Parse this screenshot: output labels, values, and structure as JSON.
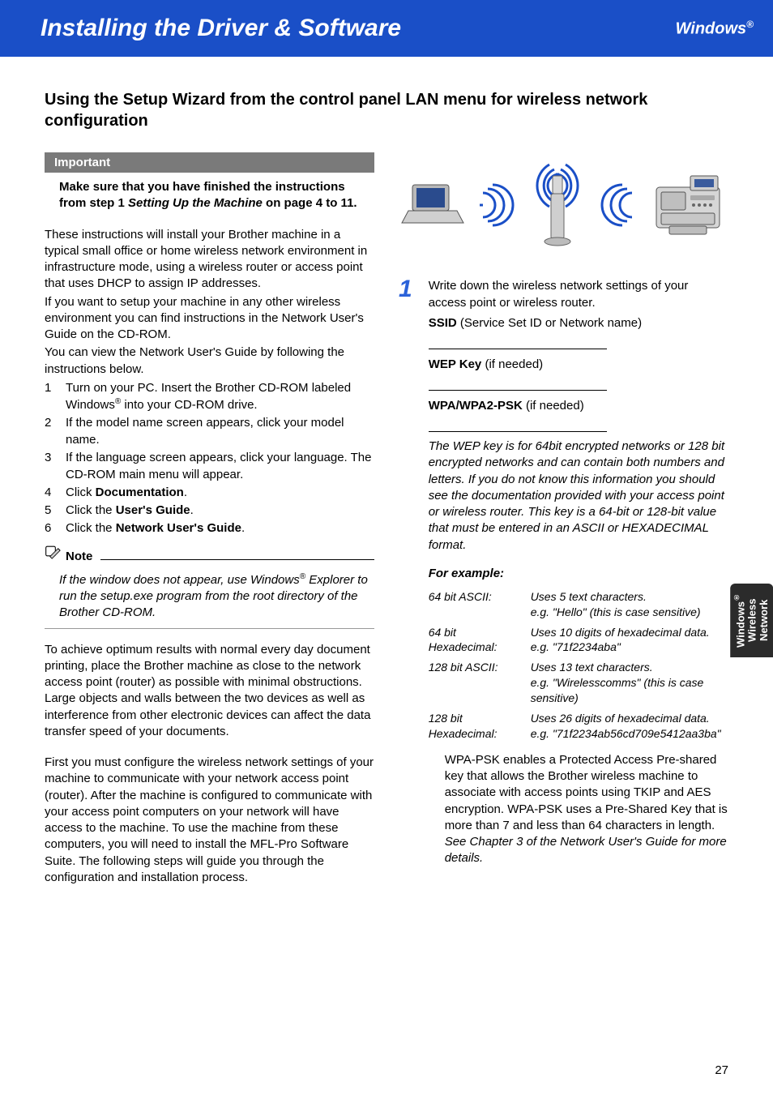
{
  "banner": {
    "title": "Installing the Driver & Software",
    "os": "Windows",
    "reg": "®"
  },
  "section_title": "Using the Setup Wizard from the control panel LAN menu for wireless network configuration",
  "important": {
    "label": "Important",
    "line1": "Make sure that you have finished the instructions from step 1",
    "line2_it": "Setting Up the Machine",
    "line3": "on page 4 to 11."
  },
  "left": {
    "p1": "These instructions will install your Brother machine in a typical small office or home wireless network environment in infrastructure mode, using a wireless router or access point that uses DHCP to assign IP addresses.",
    "p2": "If you want to setup your machine in any other wireless environment you can find instructions in the Network User's Guide on the CD-ROM.",
    "p3": "You can view the Network User's Guide by following the instructions below.",
    "li1a": "Turn on your PC. Insert the Brother CD-ROM labeled Windows",
    "li1b": " into your CD-ROM drive.",
    "li2": "If the model name screen appears, click your model name.",
    "li3": "If the language screen appears, click your language. The CD-ROM main menu will appear.",
    "li4a": "Click ",
    "li4b": "Documentation",
    "li4c": ".",
    "li5a": "Click the ",
    "li5b": "User's Guide",
    "li5c": ".",
    "li6a": "Click the ",
    "li6b": "Network User's Guide",
    "li6c": ".",
    "note_label": "Note",
    "note_body_a": "If the window does not appear, use Windows",
    "note_body_b": " Explorer to run the setup.exe program from the root directory of the Brother CD-ROM.",
    "p4": "To achieve optimum results with normal every day document printing, place the Brother machine as close to the network access point (router) as possible with minimal obstructions. Large objects and walls between the two devices as well as interference from other electronic devices can affect the data transfer speed of your documents.",
    "p5": "First you must configure the wireless network settings of your machine to communicate with your network access point (router). After the machine is configured to communicate with your access point computers on your network will have access to the machine. To use the machine from these computers, you will need to install the MFL-Pro Software Suite. The following steps will guide you through the configuration and installation process."
  },
  "right": {
    "step_num": "1",
    "step_a": "Write down the wireless network settings of your access point or wireless router.",
    "ssid_b": "SSID",
    "ssid_t": " (Service Set ID or Network name)",
    "wep_b": "WEP Key",
    "wep_t": " (if needed)",
    "wpa_b": "WPA/WPA2-PSK",
    "wpa_t": " (if needed)",
    "wep_note": "The WEP key is for 64bit encrypted networks or 128 bit encrypted networks and can contain both numbers and letters. If you do not know this information you should see the documentation provided with your access point or wireless router. This key is a 64-bit or 128-bit value that must be entered in an ASCII or HEXADECIMAL format.",
    "for_ex": "For example:",
    "ex": [
      {
        "k": "64 bit ASCII:",
        "v": "Uses 5 text characters.\ne.g. \"Hello\" (this is case sensitive)"
      },
      {
        "k": "64 bit Hexadecimal:",
        "v": "Uses 10 digits of hexadecimal data.\ne.g. \"71f2234aba\""
      },
      {
        "k": "128 bit ASCII:",
        "v": "Uses 13 text characters.\ne.g. \"Wirelesscomms\" (this is case sensitive)"
      },
      {
        "k": "128 bit Hexadecimal:",
        "v": "Uses 26 digits of hexadecimal data.\ne.g. \"71f2234ab56cd709e5412aa3ba\""
      }
    ],
    "wpa_desc": "WPA-PSK enables a Protected Access Pre-shared key that allows the Brother wireless machine to associate with access points using TKIP and AES encryption. WPA-PSK uses a Pre-Shared Key that is more than 7 and less than 64 characters in length.",
    "wpa_see": "See Chapter 3 of the Network User's Guide for more details"
  },
  "tab": {
    "l1": "Windows",
    "reg": "®",
    "l2": "Wireless",
    "l3": "Network"
  },
  "page": "27"
}
